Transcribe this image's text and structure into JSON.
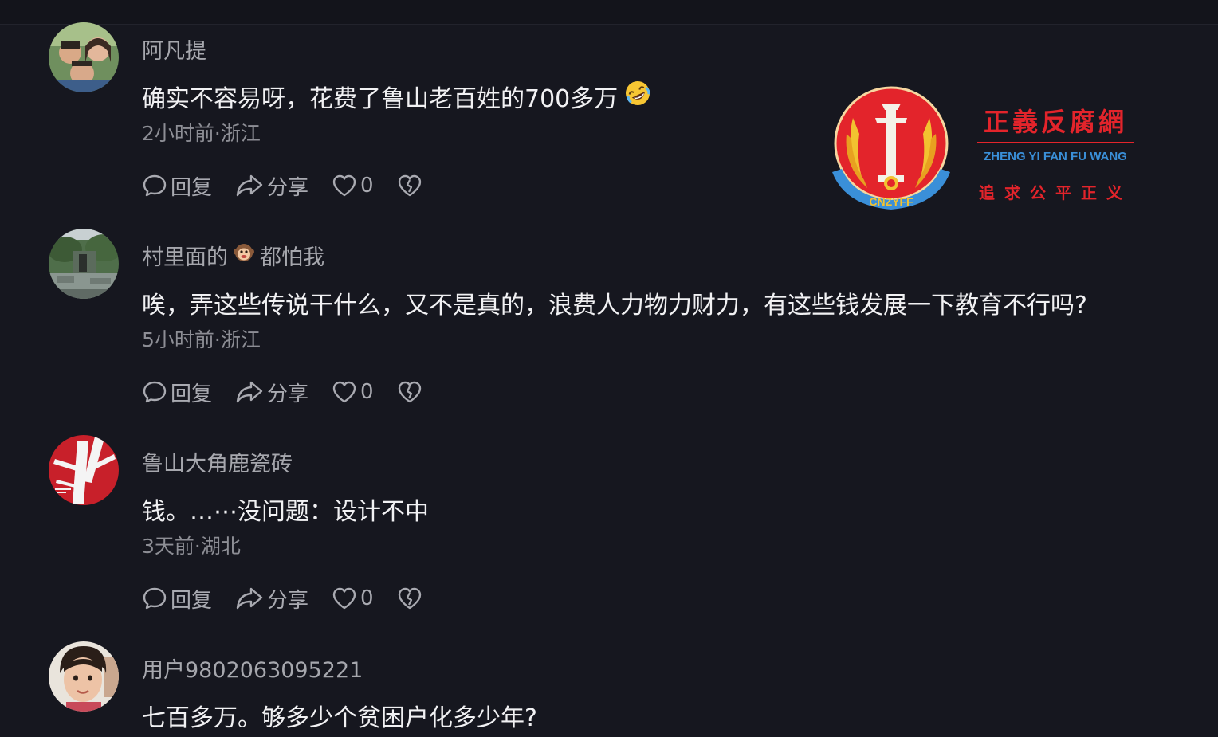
{
  "comments": [
    {
      "username": "阿凡提",
      "username_suffix": "",
      "text": "确实不容易呀，花费了鲁山老百姓的700多万",
      "text_emoji": "rolling-laughing-emoji",
      "meta": "2小时前·浙江",
      "reply_label": "回复",
      "share_label": "分享",
      "likes": "0",
      "avatar": "family-photo-avatar"
    },
    {
      "username": "村里面的",
      "username_emoji": "monkey-face-emoji",
      "username_suffix": "都怕我",
      "text": "唉，弄这些传说干什么，又不是真的，浪费人力物力财力，有这些钱发展一下教育不行吗?",
      "meta": "5小时前·浙江",
      "reply_label": "回复",
      "share_label": "分享",
      "likes": "0",
      "avatar": "garden-scene-avatar"
    },
    {
      "username": "鲁山大角鹿瓷砖",
      "username_suffix": "",
      "text": "钱。…⋯没问题：设计不中",
      "meta": "3天前·湖北",
      "reply_label": "回复",
      "share_label": "分享",
      "likes": "0",
      "avatar": "red-brand-logo-avatar"
    },
    {
      "username": "用户9802063095221",
      "username_suffix": "",
      "text": "七百多万。够多少个贫困户化多少年?",
      "avatar": "child-portrait-avatar"
    }
  ],
  "watermark": {
    "title": "正義反腐網",
    "pinyin": "ZHENG YI FAN FU WANG",
    "slogan": "追求公平正义",
    "emblem_text": "CNZYFF",
    "colors": {
      "red": "#e3242b",
      "blue": "#3a8fd8",
      "gold": "#f2c230"
    }
  },
  "colors": {
    "background": "#16171f",
    "primary_text": "#f1f1f3",
    "secondary_text": "#a6a7ad",
    "meta_text": "#8d8e95"
  }
}
